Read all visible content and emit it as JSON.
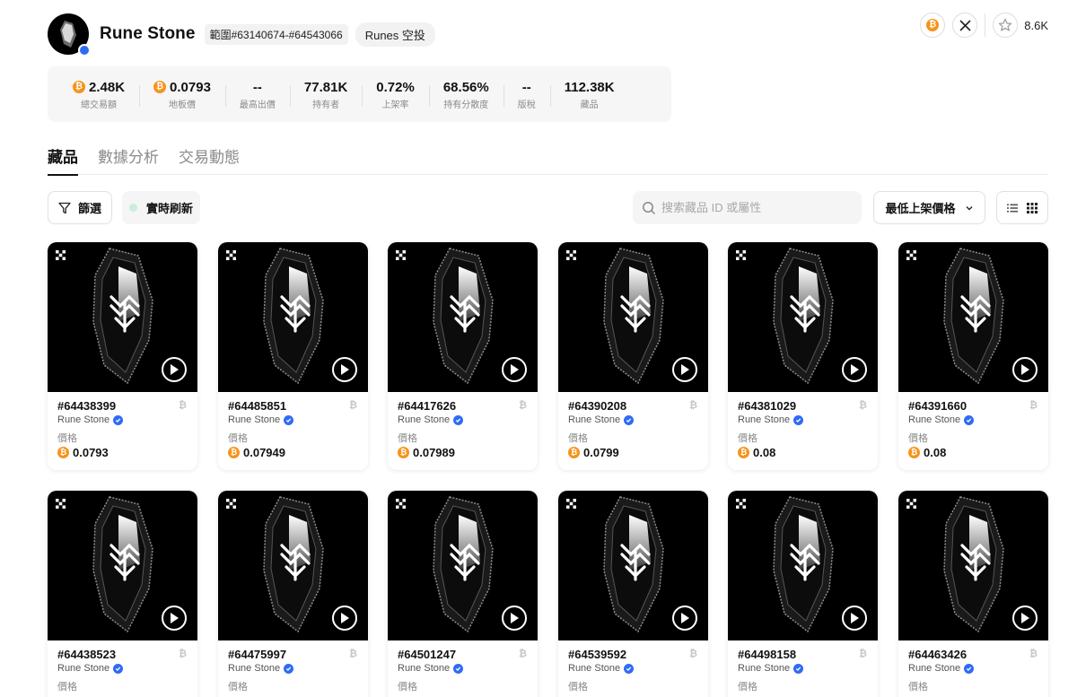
{
  "header": {
    "title": "Rune Stone",
    "range_tag": "範圍#63140674-#64543066",
    "runes_tag": "Runes 空投",
    "favorite_count": "8.6K"
  },
  "stats": [
    {
      "value": "2.48K",
      "label": "總交易額",
      "coin": "₿"
    },
    {
      "value": "0.0793",
      "label": "地板價",
      "coin": "₿"
    },
    {
      "value": "--",
      "label": "最高出價"
    },
    {
      "value": "77.81K",
      "label": "持有者"
    },
    {
      "value": "0.72%",
      "label": "上架率"
    },
    {
      "value": "68.56%",
      "label": "持有分散度"
    },
    {
      "value": "--",
      "label": "版稅"
    },
    {
      "value": "112.38K",
      "label": "藏品"
    }
  ],
  "tabs": [
    {
      "label": "藏品",
      "active": true
    },
    {
      "label": "數據分析",
      "active": false
    },
    {
      "label": "交易動態",
      "active": false
    }
  ],
  "toolbar": {
    "filter_label": "篩選",
    "refresh_label": "實時刷新",
    "search_placeholder": "搜索藏品 ID 或屬性",
    "sort_label": "最低上架價格"
  },
  "colors": {
    "btc_orange": "#f7931a",
    "verified_blue": "#2f6bf6",
    "live_dot": "#c9eed9"
  },
  "items": [
    {
      "id": "#64438399",
      "collection": "Rune Stone",
      "price_label": "價格",
      "price": "0.0793",
      "chain": "₿"
    },
    {
      "id": "#64485851",
      "collection": "Rune Stone",
      "price_label": "價格",
      "price": "0.07949",
      "chain": "₿"
    },
    {
      "id": "#64417626",
      "collection": "Rune Stone",
      "price_label": "價格",
      "price": "0.07989",
      "chain": "₿"
    },
    {
      "id": "#64390208",
      "collection": "Rune Stone",
      "price_label": "價格",
      "price": "0.0799",
      "chain": "₿"
    },
    {
      "id": "#64381029",
      "collection": "Rune Stone",
      "price_label": "價格",
      "price": "0.08",
      "chain": "₿"
    },
    {
      "id": "#64391660",
      "collection": "Rune Stone",
      "price_label": "價格",
      "price": "0.08",
      "chain": "₿"
    },
    {
      "id": "#64438523",
      "collection": "Rune Stone",
      "price_label": "價格",
      "price": "",
      "chain": "₿"
    },
    {
      "id": "#64475997",
      "collection": "Rune Stone",
      "price_label": "價格",
      "price": "",
      "chain": "₿"
    },
    {
      "id": "#64501247",
      "collection": "Rune Stone",
      "price_label": "價格",
      "price": "",
      "chain": "₿"
    },
    {
      "id": "#64539592",
      "collection": "Rune Stone",
      "price_label": "價格",
      "price": "",
      "chain": "₿"
    },
    {
      "id": "#64498158",
      "collection": "Rune Stone",
      "price_label": "價格",
      "price": "",
      "chain": "₿"
    },
    {
      "id": "#64463426",
      "collection": "Rune Stone",
      "price_label": "價格",
      "price": "",
      "chain": "₿"
    }
  ]
}
